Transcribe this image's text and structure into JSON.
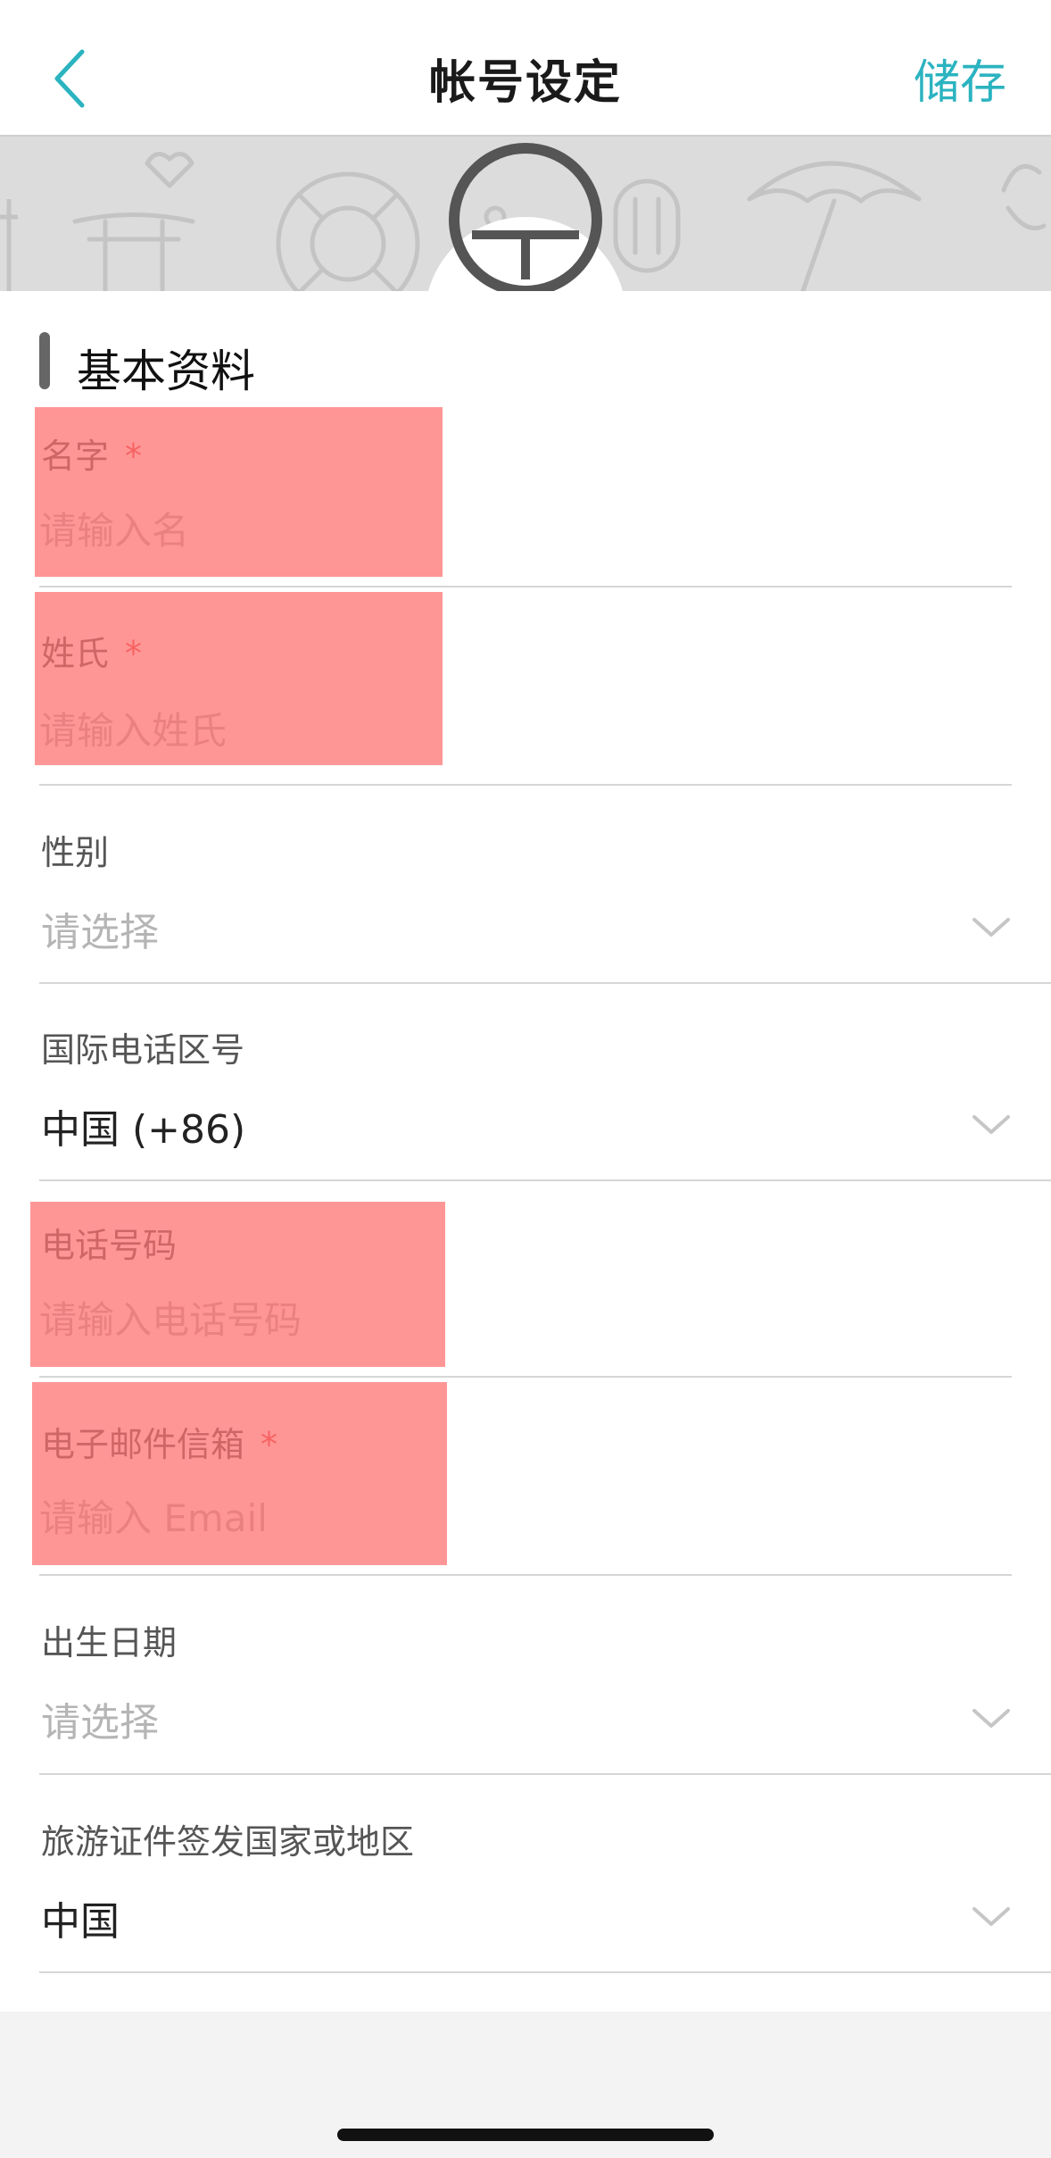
{
  "nav": {
    "title": "帐号设定",
    "save_label": "储存"
  },
  "section": {
    "title": "基本资料"
  },
  "fields": {
    "first_name": {
      "label": "名字",
      "required_mark": "*",
      "placeholder": "请输入名",
      "value": ""
    },
    "last_name": {
      "label": "姓氏",
      "required_mark": "*",
      "placeholder": "请输入姓氏",
      "value": ""
    },
    "gender": {
      "label": "性别",
      "value": "请选择"
    },
    "country_code": {
      "label": "国际电话区号",
      "value": "中国 (+86)"
    },
    "phone": {
      "label": "电话号码",
      "placeholder": "请输入电话号码",
      "value": ""
    },
    "email": {
      "label": "电子邮件信箱",
      "required_mark": "*",
      "placeholder": "请输入 Email",
      "value": ""
    },
    "birthday": {
      "label": "出生日期",
      "value": "请选择"
    },
    "issuing_country": {
      "label": "旅游证件签发国家或地区",
      "value": "中国"
    }
  },
  "icons": {
    "back": "chevron-left-icon",
    "camera": "camera-icon",
    "dropdown": "chevron-down-icon",
    "avatar": "avatar-icon"
  },
  "colors": {
    "accent": "#2bb3c0",
    "required": "#e04848",
    "placeholder": "#b5b5b5",
    "highlight": "#ff6e6e"
  }
}
